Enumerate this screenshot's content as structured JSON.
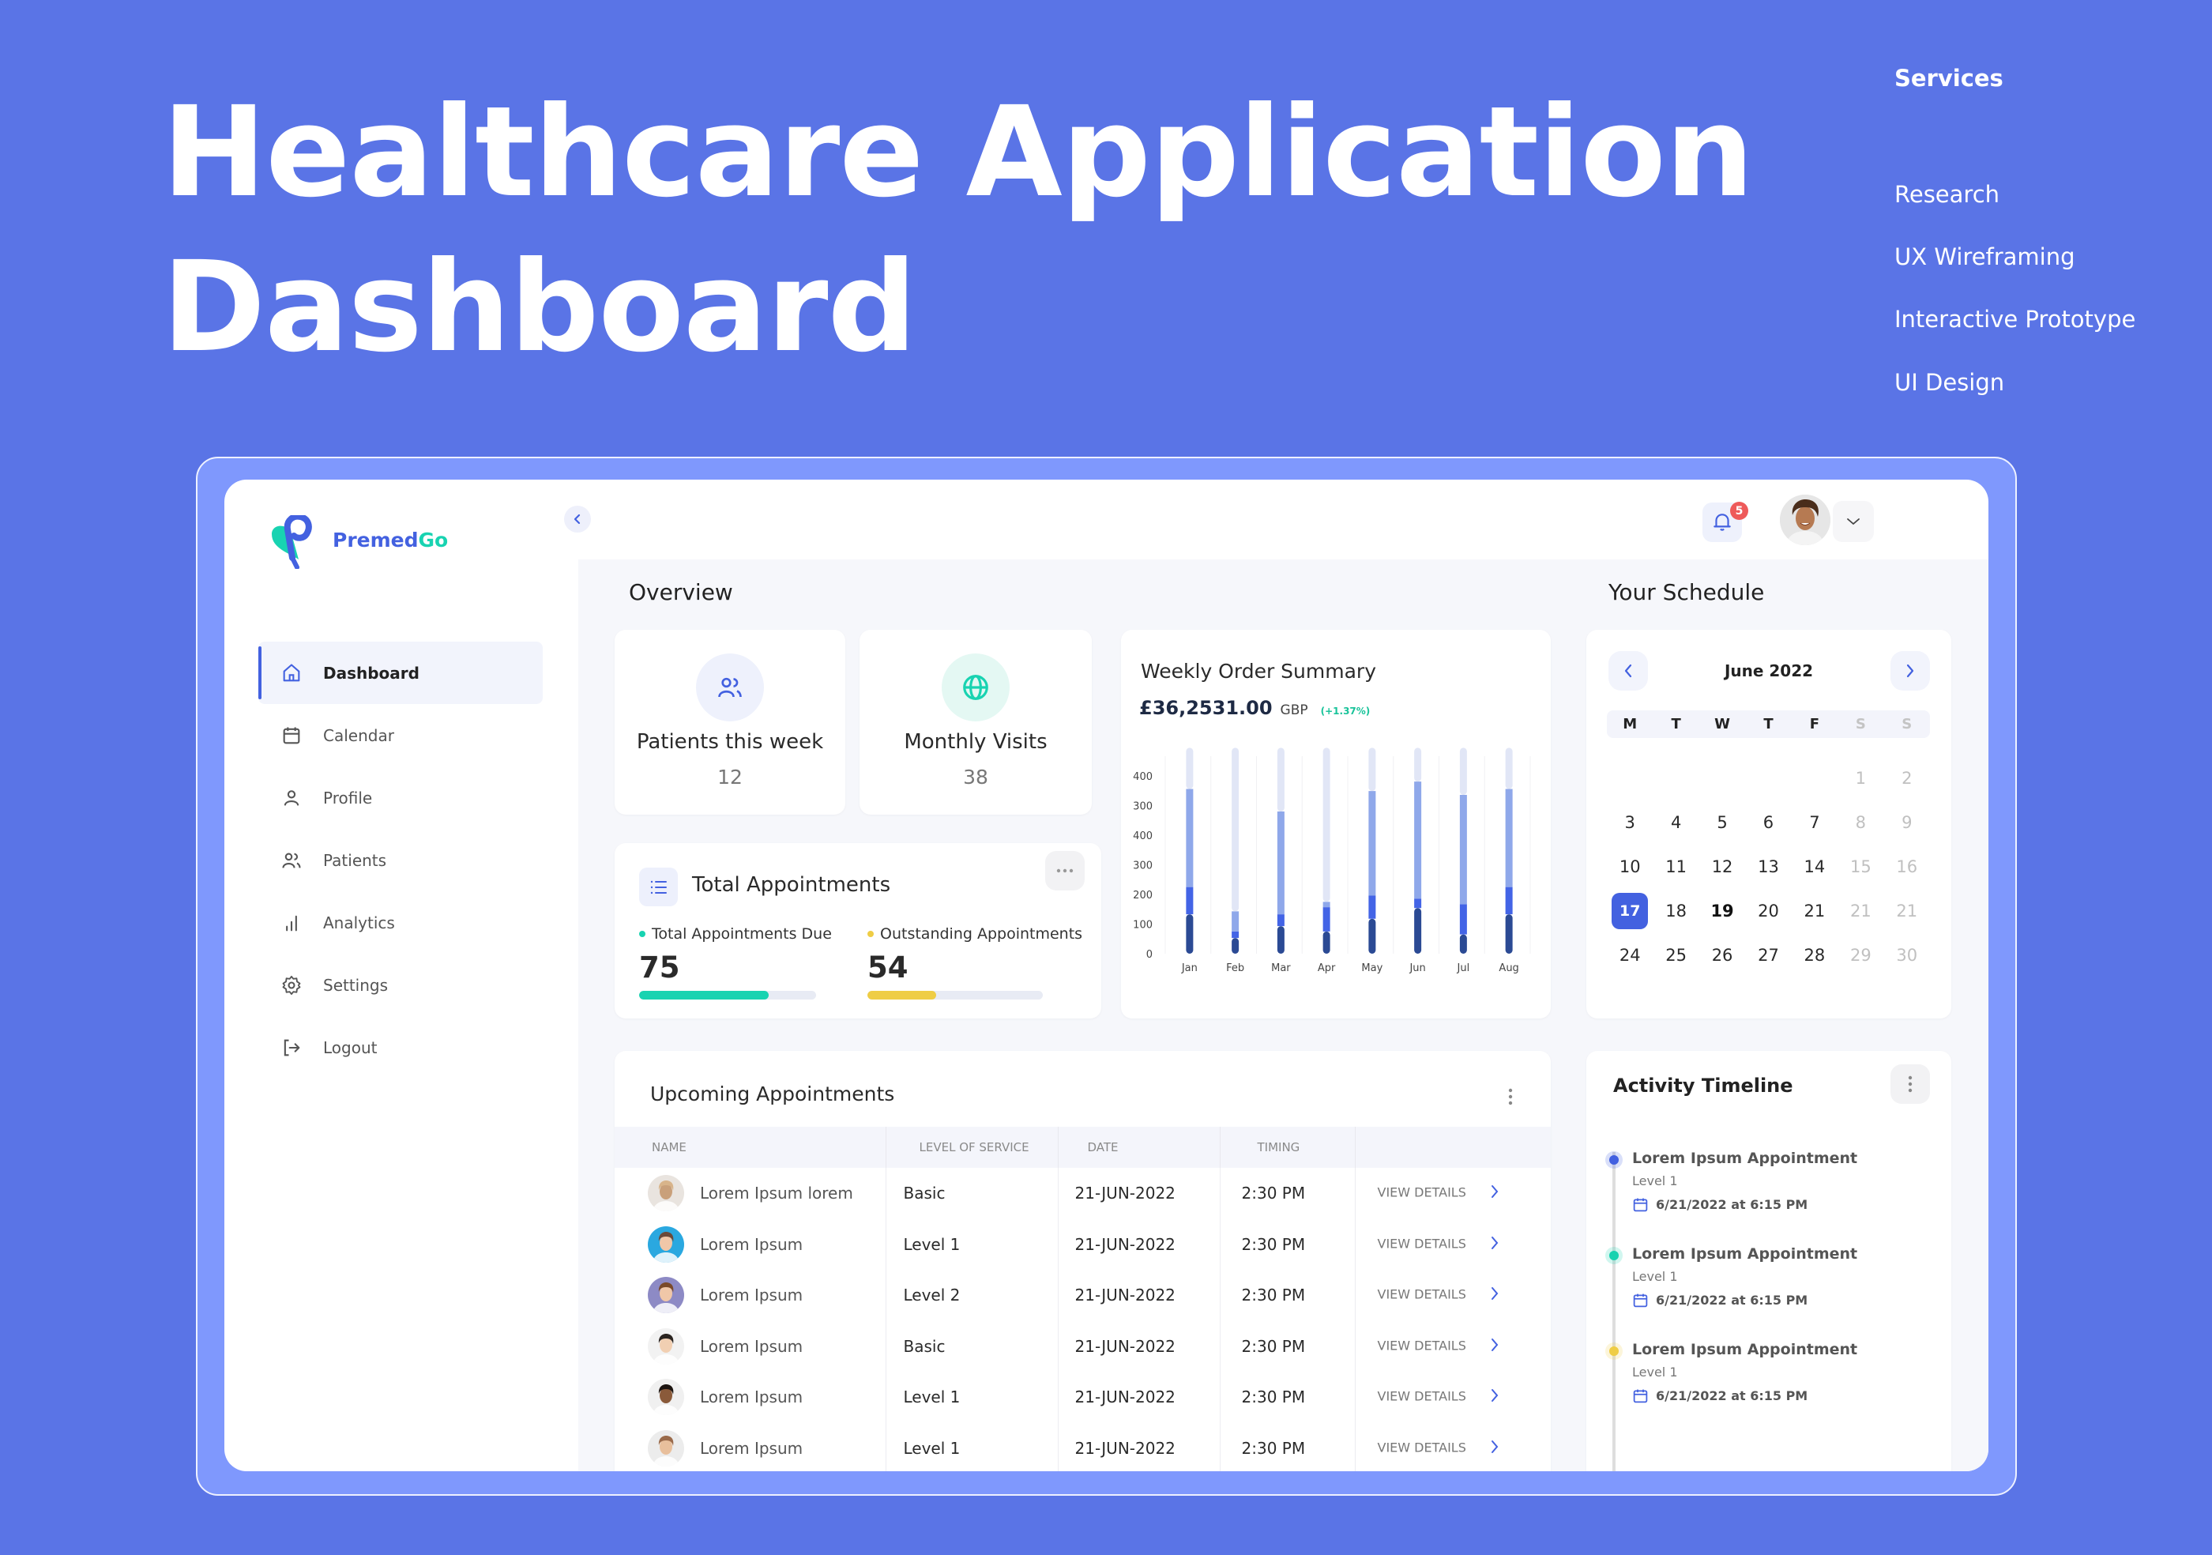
{
  "hero": {
    "title_line1": "Healthcare Application",
    "title_line2": "Dashboard"
  },
  "services": {
    "heading": "Services",
    "items": [
      "Research",
      "UX Wireframing",
      "Interactive Prototype",
      "UI Design"
    ]
  },
  "app": {
    "brand_part1": "Premed",
    "brand_part2": "Go",
    "colors": {
      "primary": "#4361e0",
      "teal": "#18d3b1",
      "yellow": "#efcd45",
      "page_bg": "#5a74e6",
      "frame_bg": "#7f98fd"
    }
  },
  "sidebar": {
    "items": [
      {
        "label": "Dashboard",
        "icon": "home-icon",
        "active": true
      },
      {
        "label": "Calendar",
        "icon": "calendar-icon"
      },
      {
        "label": "Profile",
        "icon": "user-icon"
      },
      {
        "label": "Patients",
        "icon": "users-icon"
      },
      {
        "label": "Analytics",
        "icon": "bar-chart-icon"
      },
      {
        "label": "Settings",
        "icon": "gear-icon"
      },
      {
        "label": "Logout",
        "icon": "logout-icon"
      }
    ]
  },
  "header": {
    "notification_count": "5"
  },
  "overview": {
    "title": "Overview",
    "patients": {
      "label": "Patients this week",
      "value": "12"
    },
    "visits": {
      "label": "Monthly Visits",
      "value": "38"
    },
    "total_appointments": {
      "title": "Total Appointments",
      "more": "···",
      "due": {
        "label": "Total Appointments Due",
        "value": "75",
        "progress": 0.73
      },
      "outstanding": {
        "label": "Outstanding Appointments",
        "value": "54",
        "progress": 0.39
      }
    }
  },
  "weekly": {
    "title": "Weekly Order Summary",
    "amount": "£36,2531.00",
    "currency": "GBP",
    "change": "(+1.37%)"
  },
  "chart_data": {
    "type": "bar",
    "stacked": true,
    "title": "Weekly Order Summary",
    "xlabel": "",
    "ylabel": "",
    "categories": [
      "Jan",
      "Feb",
      "Mar",
      "Apr",
      "May",
      "Jun",
      "Jul",
      "Aug"
    ],
    "y_tick_labels": [
      "0",
      "100",
      "200",
      "300",
      "400",
      "300",
      "400"
    ],
    "ylim": [
      0,
      700
    ],
    "grid": "vertical",
    "legend": "none",
    "series": [
      {
        "name": "segment-1",
        "color": "#2b4a94",
        "values": [
          133,
          53,
          93,
          75,
          118,
          154,
          65,
          133
        ]
      },
      {
        "name": "segment-2",
        "color": "#4364e6",
        "values": [
          92,
          22,
          40,
          82,
          78,
          32,
          102,
          92
        ]
      },
      {
        "name": "segment-3",
        "color": "#8fa8ea",
        "values": [
          331,
          68,
          347,
          18,
          353,
          395,
          369,
          331
        ]
      },
      {
        "name": "track",
        "color": "#e1e6f6",
        "values": [
          139,
          552,
          215,
          520,
          146,
          114,
          159,
          139
        ]
      }
    ]
  },
  "schedule": {
    "title": "Your Schedule",
    "month": "June 2022",
    "weekdays": [
      "M",
      "T",
      "W",
      "T",
      "F",
      "S",
      "S"
    ],
    "days": [
      "",
      "",
      "",
      "",
      "",
      "1",
      "2",
      "3",
      "4",
      "5",
      "6",
      "7",
      "8",
      "9",
      "10",
      "11",
      "12",
      "13",
      "14",
      "15",
      "16",
      "17",
      "18",
      "19",
      "20",
      "21",
      "21",
      "21",
      "24",
      "25",
      "26",
      "27",
      "28",
      "29",
      "30"
    ],
    "selected": "17"
  },
  "appointments": {
    "title": "Upcoming Appointments",
    "columns": [
      "NAME",
      "LEVEL OF SERVICE",
      "DATE",
      "TIMING",
      ""
    ],
    "action_label": "VIEW DETAILS",
    "rows": [
      {
        "name": "Lorem Ipsum lorem",
        "level": "Basic",
        "date": "21-JUN-2022",
        "time": "2:30 PM"
      },
      {
        "name": "Lorem Ipsum",
        "level": "Level 1",
        "date": "21-JUN-2022",
        "time": "2:30 PM"
      },
      {
        "name": "Lorem Ipsum",
        "level": "Level 2",
        "date": "21-JUN-2022",
        "time": "2:30 PM"
      },
      {
        "name": "Lorem Ipsum",
        "level": "Basic",
        "date": "21-JUN-2022",
        "time": "2:30 PM"
      },
      {
        "name": "Lorem Ipsum",
        "level": "Level 1",
        "date": "21-JUN-2022",
        "time": "2:30 PM"
      },
      {
        "name": "Lorem Ipsum",
        "level": "Level 1",
        "date": "21-JUN-2022",
        "time": "2:30 PM"
      }
    ]
  },
  "timeline": {
    "title": "Activity Timeline",
    "items": [
      {
        "title": "Lorem Ipsum Appointment",
        "level": "Level 1",
        "datetime": "6/21/2022 at 6:15 PM",
        "color": "#4361e0"
      },
      {
        "title": "Lorem Ipsum Appointment",
        "level": "Level 1",
        "datetime": "6/21/2022 at 6:15 PM",
        "color": "#18d3b1"
      },
      {
        "title": "Lorem Ipsum Appointment",
        "level": "Level 1",
        "datetime": "6/21/2022 at 6:15 PM",
        "color": "#efcd45"
      }
    ]
  }
}
